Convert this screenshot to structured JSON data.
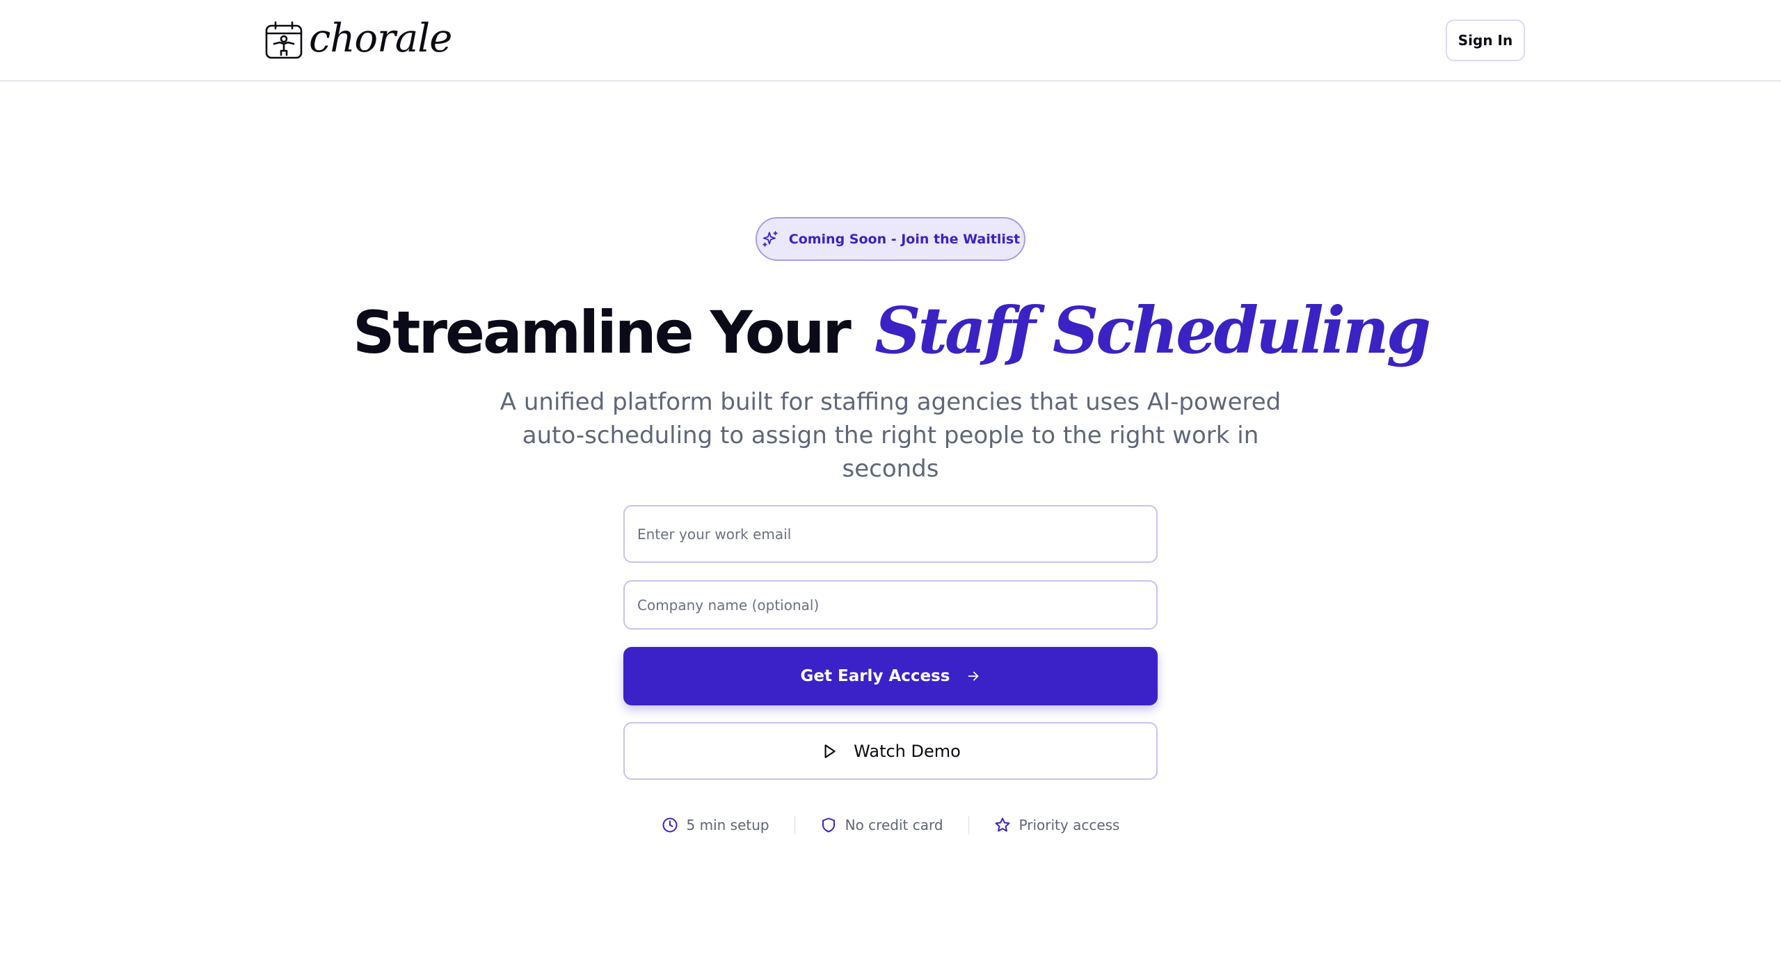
{
  "brand": {
    "name": "chorale",
    "icon": "calendar-person-icon"
  },
  "header": {
    "sign_in_label": "Sign In"
  },
  "hero": {
    "badge_icon": "sparkles-icon",
    "badge_text": "Coming Soon - Join the Waitlist",
    "headline_plain": "Streamline Your",
    "headline_accent": "Staff Scheduling",
    "subheadline": "A unified platform built for staffing agencies that uses AI-powered auto-scheduling to assign the right people to the right work in seconds"
  },
  "form": {
    "email_placeholder": "Enter your work email",
    "email_value": "",
    "company_placeholder": "Company name (optional)",
    "company_value": "",
    "cta_label": "Get Early Access",
    "cta_icon": "arrow-right-icon",
    "demo_label": "Watch Demo",
    "demo_icon": "play-icon"
  },
  "features": [
    {
      "icon": "clock-icon",
      "label": "5 min setup"
    },
    {
      "icon": "shield-icon",
      "label": "No credit card"
    },
    {
      "icon": "star-icon",
      "label": "Priority access"
    }
  ],
  "colors": {
    "accent": "#3b22c4",
    "button": "#3b21c8",
    "badge_bg": "#ece8fb",
    "muted_text": "#5f6679"
  }
}
